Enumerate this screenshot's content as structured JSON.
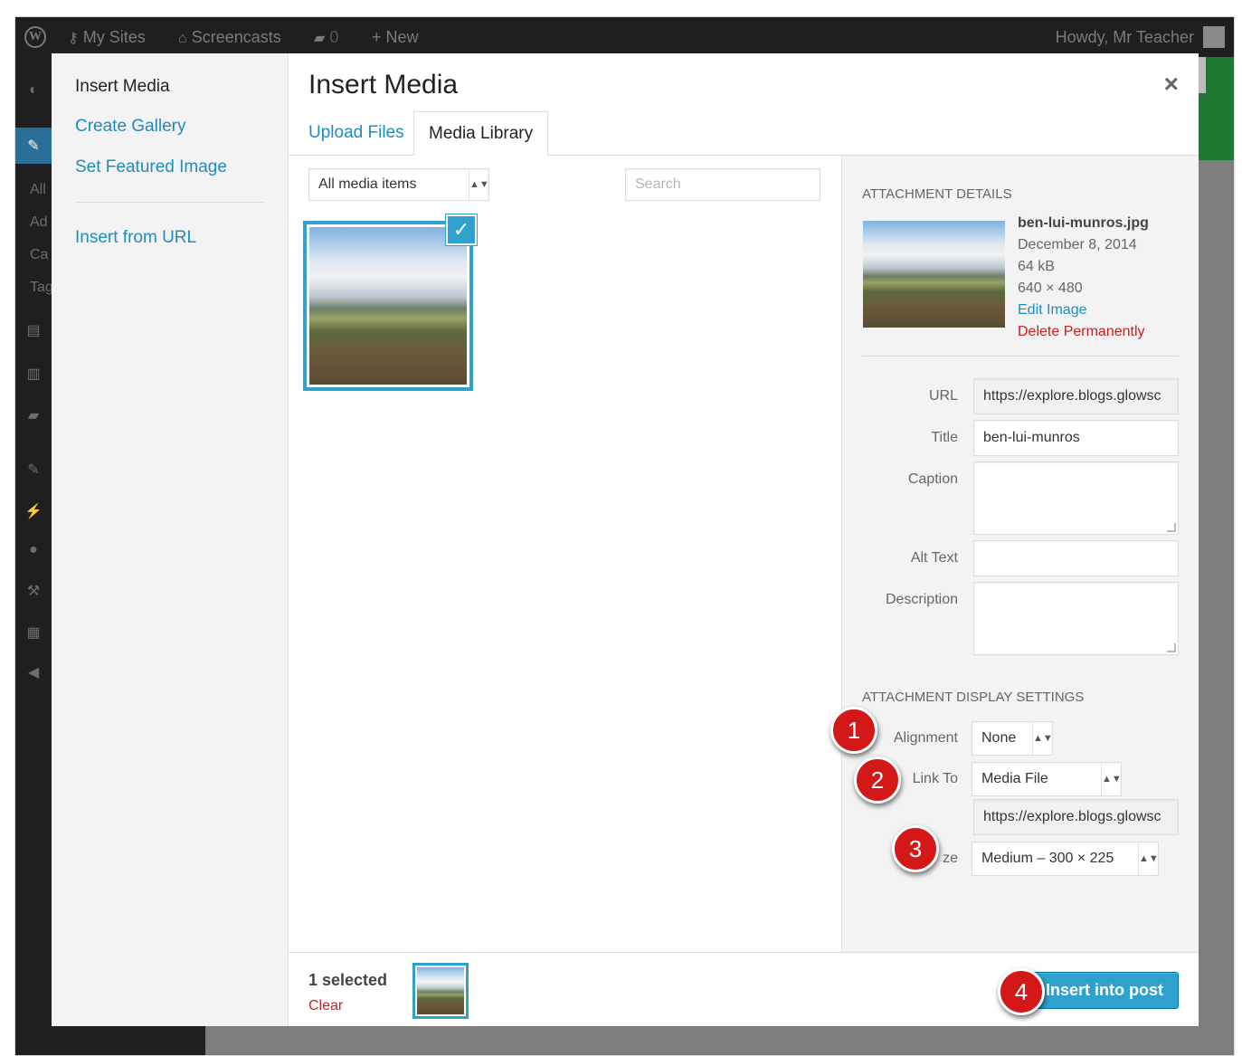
{
  "adminbar": {
    "my_sites": "My Sites",
    "site": "Screencasts",
    "comments": "0",
    "new": "New",
    "howdy": "Howdy, Mr Teacher"
  },
  "adminmenu": {
    "sub": [
      "All",
      "Ad",
      "Ca",
      "Tag"
    ]
  },
  "media_menu": {
    "items": [
      "Insert Media",
      "Create Gallery",
      "Set Featured Image",
      "Insert from URL"
    ]
  },
  "modal": {
    "title": "Insert Media",
    "close": "×",
    "tabs": [
      "Upload Files",
      "Media Library"
    ]
  },
  "toolbar": {
    "filter_value": "All media items",
    "search_placeholder": "Search"
  },
  "attachment": {
    "heading": "Attachment Details",
    "filename": "ben-lui-munros.jpg",
    "date": "December 8, 2014",
    "size": "64 kB",
    "dimensions": "640 × 480",
    "edit": "Edit Image",
    "delete": "Delete Permanently",
    "fields": {
      "url_label": "URL",
      "url_value": "https://explore.blogs.glowsc",
      "title_label": "Title",
      "title_value": "ben-lui-munros",
      "caption_label": "Caption",
      "alt_label": "Alt Text",
      "description_label": "Description"
    }
  },
  "display": {
    "heading": "Attachment Display Settings",
    "alignment_label": "Alignment",
    "alignment_value": "None",
    "link_label": "Link To",
    "link_value": "Media File",
    "link_url": "https://explore.blogs.glowsc",
    "size_label": "ze",
    "size_value": "Medium – 300 × 225"
  },
  "footer": {
    "selected": "1 selected",
    "clear": "Clear",
    "insert": "Insert into post"
  },
  "annotations": [
    "1",
    "2",
    "3",
    "4"
  ],
  "colors": {
    "accent": "#2ea2cc",
    "link": "#1e8cbe",
    "danger": "#d11a1a",
    "annotation": "#d41818"
  }
}
